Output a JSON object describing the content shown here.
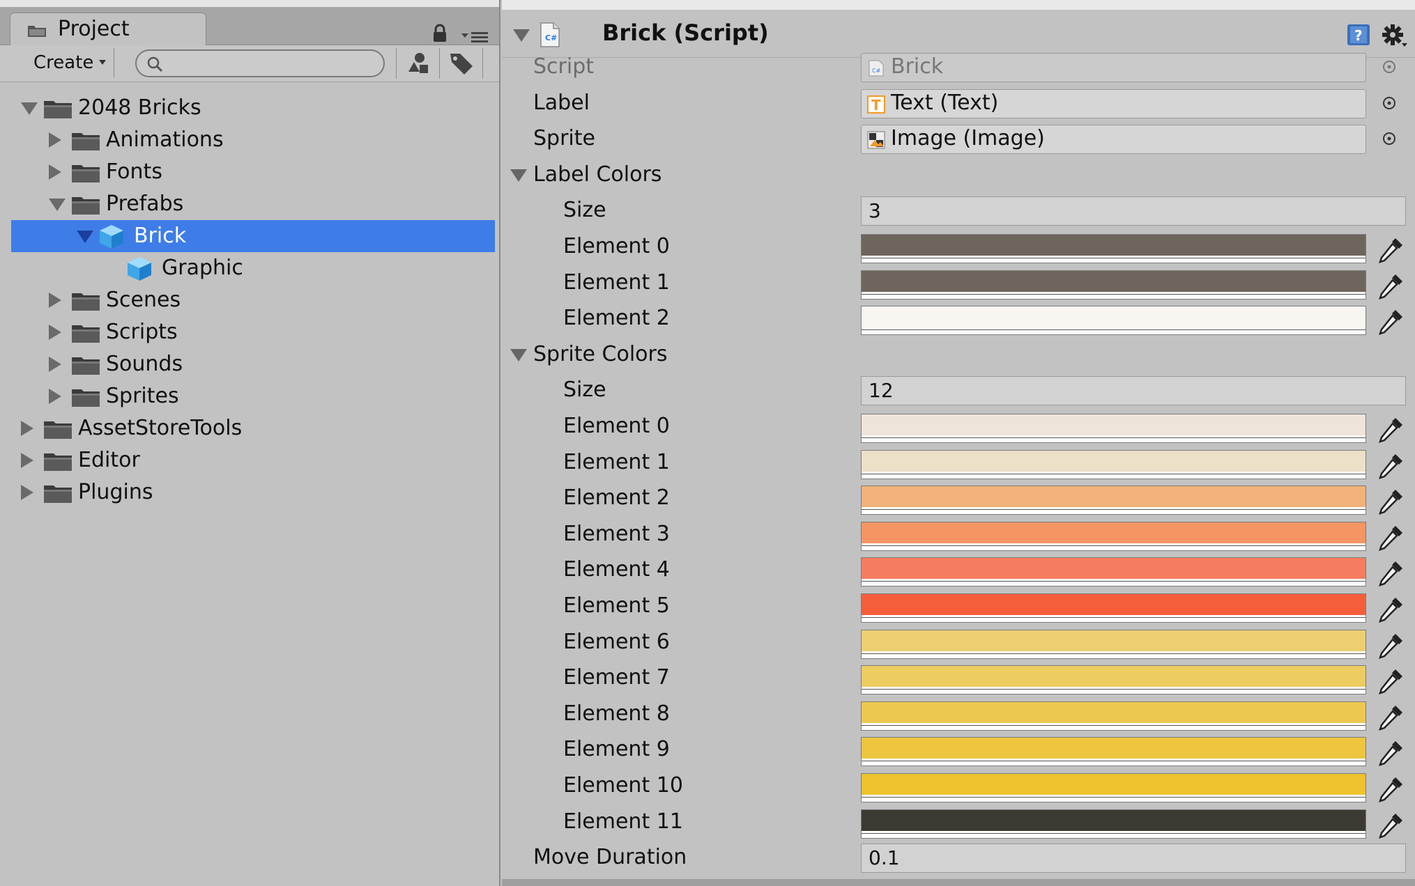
{
  "project": {
    "tab_label": "Project",
    "create_label": "Create",
    "search_placeholder": "",
    "tree": [
      {
        "label": "2048 Bricks",
        "depth": 0,
        "arrow": "down",
        "icon": "folder",
        "selected": false
      },
      {
        "label": "Animations",
        "depth": 1,
        "arrow": "right",
        "icon": "folder",
        "selected": false
      },
      {
        "label": "Fonts",
        "depth": 1,
        "arrow": "right",
        "icon": "folder",
        "selected": false
      },
      {
        "label": "Prefabs",
        "depth": 1,
        "arrow": "down",
        "icon": "folder",
        "selected": false
      },
      {
        "label": "Brick",
        "depth": 2,
        "arrow": "down",
        "icon": "prefab",
        "selected": true
      },
      {
        "label": "Graphic",
        "depth": 3,
        "arrow": "none",
        "icon": "prefab",
        "selected": false
      },
      {
        "label": "Scenes",
        "depth": 1,
        "arrow": "right",
        "icon": "folder",
        "selected": false
      },
      {
        "label": "Scripts",
        "depth": 1,
        "arrow": "right",
        "icon": "folder",
        "selected": false
      },
      {
        "label": "Sounds",
        "depth": 1,
        "arrow": "right",
        "icon": "folder",
        "selected": false
      },
      {
        "label": "Sprites",
        "depth": 1,
        "arrow": "right",
        "icon": "folder",
        "selected": false
      },
      {
        "label": "AssetStoreTools",
        "depth": 0,
        "arrow": "right",
        "icon": "folder",
        "selected": false
      },
      {
        "label": "Editor",
        "depth": 0,
        "arrow": "right",
        "icon": "folder",
        "selected": false
      },
      {
        "label": "Plugins",
        "depth": 0,
        "arrow": "right",
        "icon": "folder",
        "selected": false
      }
    ]
  },
  "inspector": {
    "component_title": "Brick (Script)",
    "rows": [
      {
        "kind": "object",
        "label": "Script",
        "value": "Brick",
        "icon": "cs-script-icon",
        "dim": true
      },
      {
        "kind": "object",
        "label": "Label",
        "value": "Text (Text)",
        "icon": "text-component-icon",
        "dim": false
      },
      {
        "kind": "object",
        "label": "Sprite",
        "value": "Image (Image)",
        "icon": "image-component-icon",
        "dim": false
      },
      {
        "kind": "foldout",
        "label": "Label Colors"
      },
      {
        "kind": "number",
        "label": "Size",
        "value": "3"
      },
      {
        "kind": "color",
        "label": "Element 0",
        "color": "#6e655d"
      },
      {
        "kind": "color",
        "label": "Element 1",
        "color": "#6e655d"
      },
      {
        "kind": "color",
        "label": "Element 2",
        "color": "#f9f6f2"
      },
      {
        "kind": "foldout",
        "label": "Sprite Colors"
      },
      {
        "kind": "number",
        "label": "Size",
        "value": "12"
      },
      {
        "kind": "color",
        "label": "Element 0",
        "color": "#eee4da"
      },
      {
        "kind": "color",
        "label": "Element 1",
        "color": "#ede0c8"
      },
      {
        "kind": "color",
        "label": "Element 2",
        "color": "#f2b179"
      },
      {
        "kind": "color",
        "label": "Element 3",
        "color": "#f59563"
      },
      {
        "kind": "color",
        "label": "Element 4",
        "color": "#f67c5f"
      },
      {
        "kind": "color",
        "label": "Element 5",
        "color": "#f65e3b"
      },
      {
        "kind": "color",
        "label": "Element 6",
        "color": "#edcf72"
      },
      {
        "kind": "color",
        "label": "Element 7",
        "color": "#edcc61"
      },
      {
        "kind": "color",
        "label": "Element 8",
        "color": "#edc850"
      },
      {
        "kind": "color",
        "label": "Element 9",
        "color": "#edc53f"
      },
      {
        "kind": "color",
        "label": "Element 10",
        "color": "#edc22e"
      },
      {
        "kind": "color",
        "label": "Element 11",
        "color": "#3c3a32"
      },
      {
        "kind": "number",
        "label": "Move Duration",
        "value": "0.1"
      }
    ]
  }
}
